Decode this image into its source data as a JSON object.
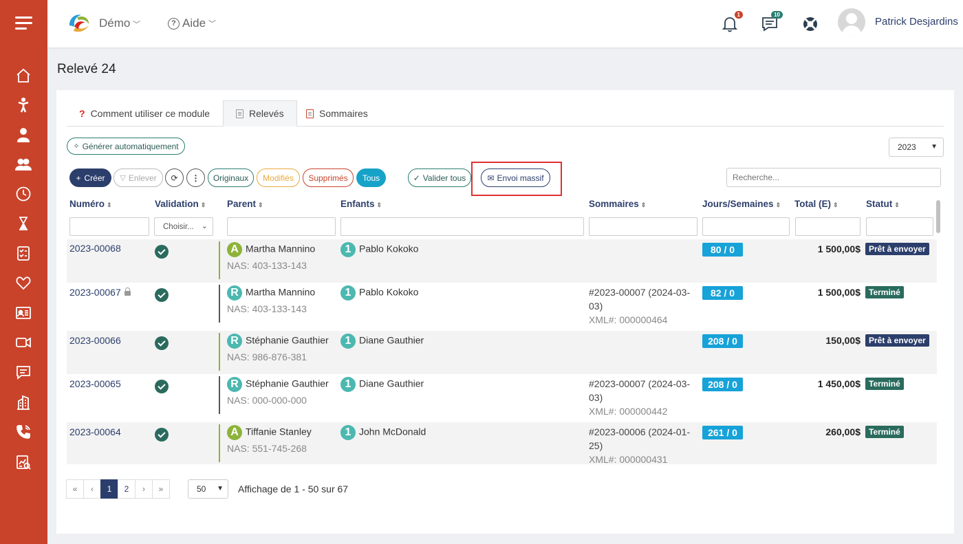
{
  "topbar": {
    "brand": "Démo",
    "help": "Aide",
    "notifications_count": "1",
    "messages_count": "10",
    "username": "Patrick Desjardins"
  },
  "page": {
    "title": "Relevé 24"
  },
  "tabs": [
    {
      "label": "Comment utiliser ce module"
    },
    {
      "label": "Relevés"
    },
    {
      "label": "Sommaires"
    }
  ],
  "toolbar": {
    "generate": "Générer automatiquement",
    "year": "2023",
    "create": "Créer",
    "remove": "Enlever",
    "originals": "Originaux",
    "modified": "Modifiés",
    "deleted": "Supprimés",
    "all": "Tous",
    "validate_all": "Valider tous",
    "bulk_send": "Envoi massif",
    "search_placeholder": "Recherche..."
  },
  "table": {
    "headers": [
      "Numéro",
      "Validation",
      "Parent",
      "Enfants",
      "Sommaires",
      "Jours/Semaines",
      "Total (E)",
      "Statut"
    ],
    "validation_filter": "Choisir...",
    "rows": [
      {
        "numero": "2023-00068",
        "locked": false,
        "parent_letter": "A",
        "parent": "Martha Mannino",
        "nas": "NAS: 403-133-143",
        "child_num": "1",
        "child": "Pablo Kokoko",
        "sommaire_1": "",
        "sommaire_2": "",
        "xml": "",
        "jours": "80 / 0",
        "total": "1 500,00$",
        "statut": "Prêt à envoyer"
      },
      {
        "numero": "2023-00067",
        "locked": true,
        "parent_letter": "R",
        "parent": "Martha Mannino",
        "nas": "NAS: 403-133-143",
        "child_num": "1",
        "child": "Pablo Kokoko",
        "sommaire_1": "#2023-00007 (2024-03-",
        "sommaire_2": "03)",
        "xml": "XML#: 000000464",
        "jours": "82 / 0",
        "total": "1 500,00$",
        "statut": "Terminé"
      },
      {
        "numero": "2023-00066",
        "locked": false,
        "parent_letter": "R",
        "parent": "Stéphanie Gauthier",
        "nas": "NAS: 986-876-381",
        "child_num": "1",
        "child": "Diane Gauthier",
        "sommaire_1": "",
        "sommaire_2": "",
        "xml": "",
        "jours": "208 / 0",
        "total": "150,00$",
        "statut": "Prêt à envoyer"
      },
      {
        "numero": "2023-00065",
        "locked": false,
        "parent_letter": "R",
        "parent": "Stéphanie Gauthier",
        "nas": "NAS: 000-000-000",
        "child_num": "1",
        "child": "Diane Gauthier",
        "sommaire_1": "#2023-00007 (2024-03-",
        "sommaire_2": "03)",
        "xml": "XML#: 000000442",
        "jours": "208 / 0",
        "total": "1 450,00$",
        "statut": "Terminé"
      },
      {
        "numero": "2023-00064",
        "locked": false,
        "parent_letter": "A",
        "parent": "Tiffanie Stanley",
        "nas": "NAS: 551-745-268",
        "child_num": "1",
        "child": "John McDonald",
        "sommaire_1": "#2023-00006 (2024-01-",
        "sommaire_2": "25)",
        "xml": "XML#: 000000431",
        "jours": "261 / 0",
        "total": "260,00$",
        "statut": "Terminé"
      }
    ]
  },
  "pagination": {
    "first": "«",
    "prev": "‹",
    "pages": [
      "1",
      "2"
    ],
    "next": "›",
    "last": "»",
    "per_page": "50",
    "info": "Affichage de 1 - 50 sur 67"
  },
  "colors": {
    "sidebar": "#c9432b",
    "primary": "#2c3e6b",
    "teal": "#2a6b5e",
    "accent": "#17a2d8"
  },
  "sidebar_icons": [
    "menu-icon",
    "home-icon",
    "child-icon",
    "user-icon",
    "users-icon",
    "clock-icon",
    "hourglass-icon",
    "checklist-icon",
    "heart-icon",
    "id-card-icon",
    "video-icon",
    "chat-icon",
    "building-icon",
    "phone-icon",
    "report-icon"
  ]
}
